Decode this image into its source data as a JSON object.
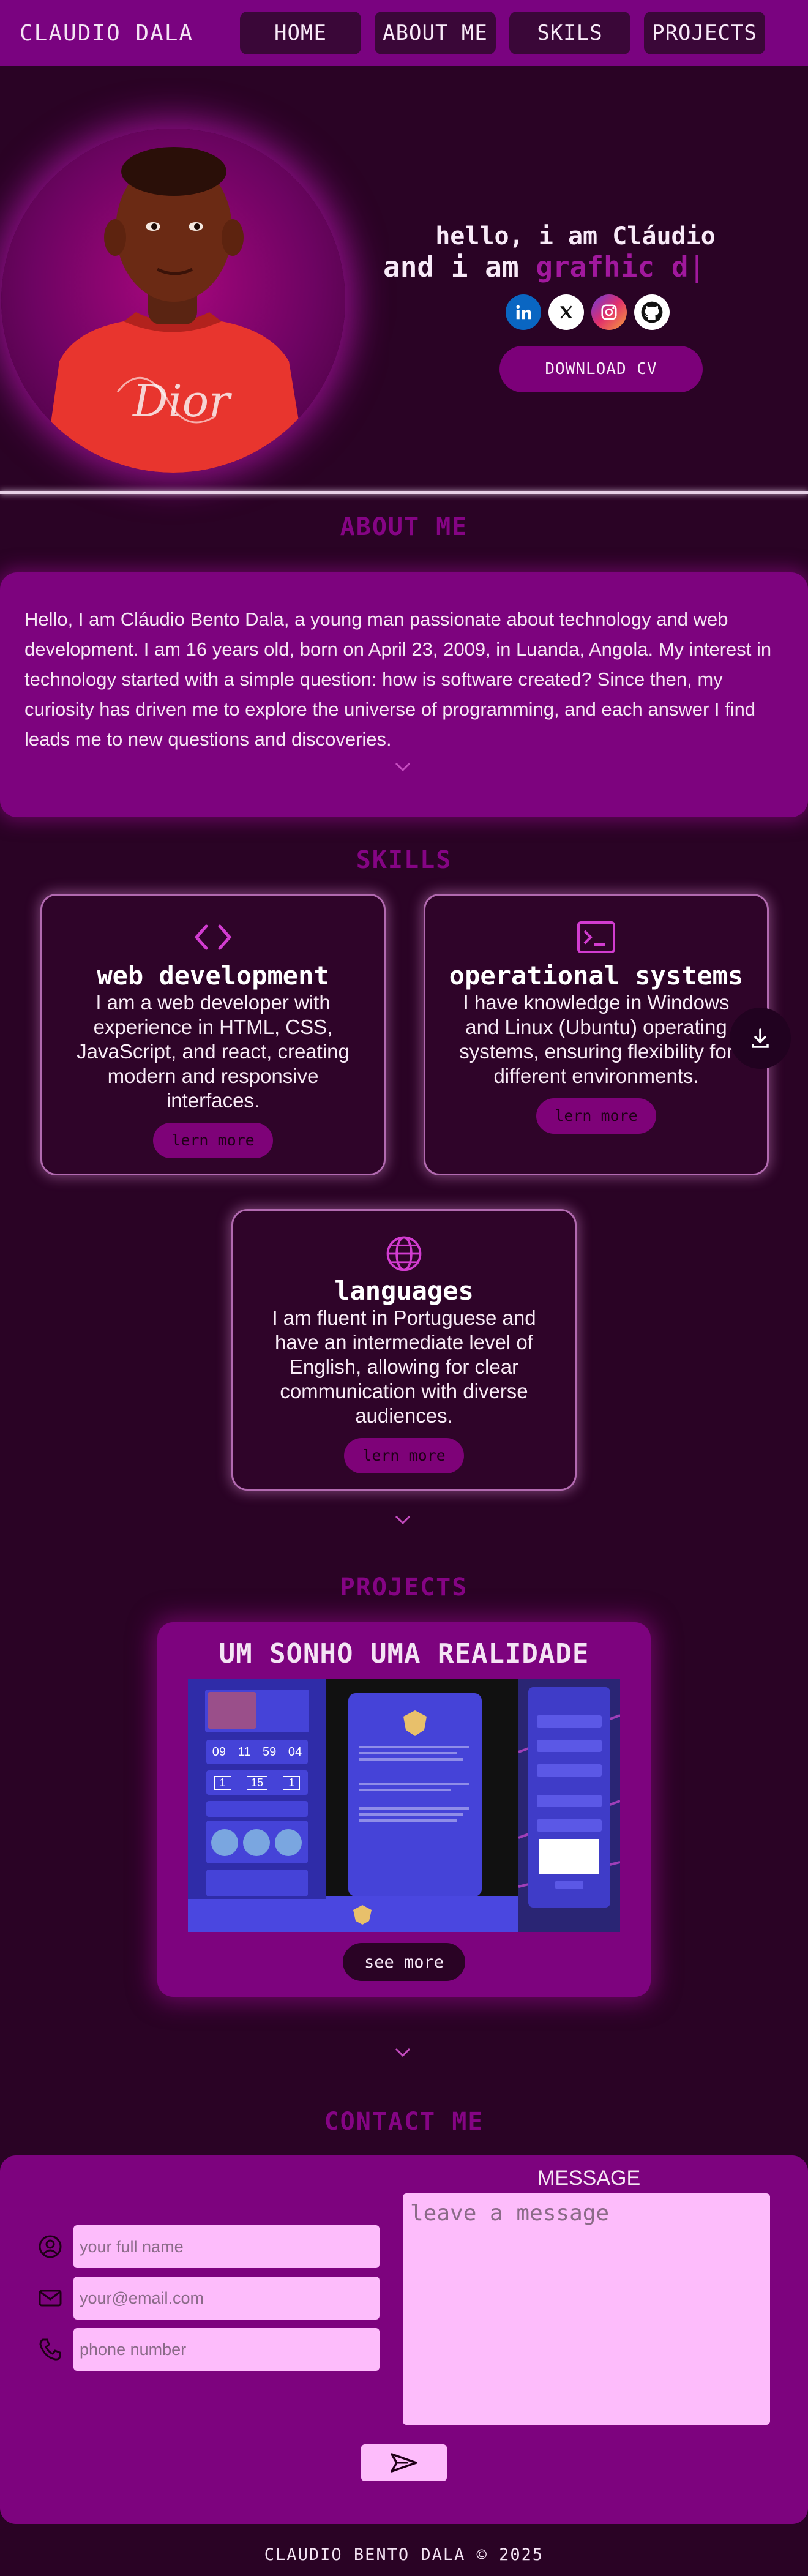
{
  "nav": {
    "brand": "CLAUDIO DALA",
    "links": [
      "HOME",
      "ABOUT ME",
      "SKILS",
      "PROJECTS"
    ]
  },
  "hero": {
    "greeting": "hello, i am Cláudio",
    "role_prefix": "and i am",
    "role_typed": "grafhic d",
    "cursor": "|",
    "socials": [
      "linkedin-icon",
      "x-icon",
      "instagram-icon",
      "github-icon"
    ],
    "download_label": "DOWNLOAD CV",
    "shirt_text": "Dior"
  },
  "about": {
    "title": "ABOUT ME",
    "text": "Hello, I am Cláudio Bento Dala, a young man passionate about technology and web development. I am 16 years old, born on April 23, 2009, in Luanda, Angola. My interest in technology started with a simple question: how is software created? Since then, my curiosity has driven me to explore the universe of programming, and each answer I find leads me to new questions and discoveries."
  },
  "skills": {
    "title": "SKILLS",
    "items": [
      {
        "icon": "code-icon",
        "title": "web development",
        "desc": "I am a web developer with experience in HTML, CSS, JavaScript, and react, creating modern and responsive interfaces.",
        "button": "lern more"
      },
      {
        "icon": "terminal-icon",
        "title": "operational systems",
        "desc": "I have knowledge in Windows and Linux (Ubuntu) operating systems, ensuring flexibility for different environments.",
        "button": "lern more"
      },
      {
        "icon": "globe-icon",
        "title": "languages",
        "desc": "I am fluent in Portuguese and have an intermediate level of English, allowing for clear communication with diverse audiences.",
        "button": "lern more"
      }
    ]
  },
  "projects": {
    "title": "PROJECTS",
    "card_title": "UM SONHO UMA REALIDADE",
    "countdown": [
      "09",
      "11",
      "59",
      "04"
    ],
    "mini_counters": [
      "1",
      "15",
      "1"
    ],
    "button": "see more"
  },
  "contact": {
    "title": "CONTACT ME",
    "message_label": "MESSAGE",
    "message_placeholder": "leave a message",
    "name_placeholder": "your full name",
    "email_placeholder": "your@email.com",
    "phone_placeholder": "phone number"
  },
  "footer": {
    "text": "CLAUDIO BENTO DALA © 2025"
  },
  "colors": {
    "background": "#2a0325",
    "accent": "#7d037e",
    "title": "#850484",
    "input": "#fdbcfb"
  }
}
